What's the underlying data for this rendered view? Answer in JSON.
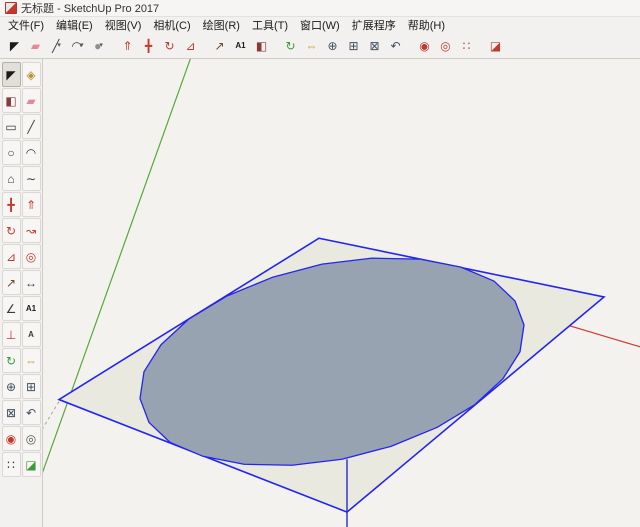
{
  "window": {
    "title": "无标题 - SketchUp Pro 2017"
  },
  "menu": {
    "items": [
      {
        "name": "menu-file",
        "label": "文件(F)"
      },
      {
        "name": "menu-edit",
        "label": "编辑(E)"
      },
      {
        "name": "menu-view",
        "label": "视图(V)"
      },
      {
        "name": "menu-camera",
        "label": "相机(C)"
      },
      {
        "name": "menu-draw",
        "label": "绘图(R)"
      },
      {
        "name": "menu-tools",
        "label": "工具(T)"
      },
      {
        "name": "menu-window",
        "label": "窗口(W)"
      },
      {
        "name": "menu-extensions",
        "label": "扩展程序"
      },
      {
        "name": "menu-help",
        "label": "帮助(H)"
      }
    ]
  },
  "top_toolbar": {
    "items": [
      {
        "name": "select-tool",
        "glyph": "◤",
        "color": "#1a1a1a"
      },
      {
        "name": "eraser-tool",
        "glyph": "▰",
        "color": "#e4889a"
      },
      {
        "name": "line-tool",
        "glyph": "╱",
        "color": "#3a3a3a",
        "dropdown": true
      },
      {
        "name": "arc-tool",
        "glyph": "◠",
        "color": "#3a3a3a",
        "dropdown": true
      },
      {
        "name": "shapes-tool",
        "glyph": "●",
        "color": "#8f8f8f",
        "dropdown": true
      },
      {
        "type": "sep"
      },
      {
        "name": "push-pull-tool",
        "glyph": "⇑",
        "color": "#c03a2e"
      },
      {
        "name": "move-tool",
        "glyph": "╋",
        "color": "#c03a2e"
      },
      {
        "name": "rotate-tool",
        "glyph": "↻",
        "color": "#c03a2e"
      },
      {
        "name": "scale-tool",
        "glyph": "⊿",
        "color": "#c03a2e"
      },
      {
        "type": "sep"
      },
      {
        "name": "tape-measure-tool",
        "glyph": "↗",
        "color": "#6b4a2a"
      },
      {
        "name": "text-tool",
        "glyph": "A1",
        "color": "#1a1a1a",
        "small": true
      },
      {
        "name": "paint-bucket-tool",
        "glyph": "◧",
        "color": "#8b3a3a"
      },
      {
        "type": "sep"
      },
      {
        "name": "orbit-tool",
        "glyph": "↻",
        "color": "#3a9b3a"
      },
      {
        "name": "pan-tool",
        "glyph": "⇔",
        "color": "#c9a23a"
      },
      {
        "name": "zoom-tool",
        "glyph": "⊕",
        "color": "#41505e"
      },
      {
        "name": "zoom-window-tool",
        "glyph": "⊞",
        "color": "#41505e"
      },
      {
        "name": "zoom-extents-tool",
        "glyph": "⊠",
        "color": "#41505e"
      },
      {
        "name": "previous-view-tool",
        "glyph": "↶",
        "color": "#41505e"
      },
      {
        "type": "sep"
      },
      {
        "name": "position-camera-tool",
        "glyph": "◉",
        "color": "#c03a2e"
      },
      {
        "name": "look-around-tool",
        "glyph": "◎",
        "color": "#c03a2e"
      },
      {
        "name": "walk-tool",
        "glyph": "∷",
        "color": "#c03a2e"
      },
      {
        "type": "sep"
      },
      {
        "name": "section-plane-tool",
        "glyph": "◪",
        "color": "#c03a2e"
      }
    ]
  },
  "left_toolbar": {
    "items": [
      {
        "name": "select-tool",
        "glyph": "◤",
        "color": "#1a1a1a",
        "active": true
      },
      {
        "name": "make-component-tool",
        "glyph": "◈",
        "color": "#b8912f"
      },
      {
        "name": "paint-bucket-tool",
        "glyph": "◧",
        "color": "#8b3a3a"
      },
      {
        "name": "eraser-tool",
        "glyph": "▰",
        "color": "#e4889a"
      },
      {
        "name": "rectangle-tool",
        "glyph": "▭",
        "color": "#3a3a3a"
      },
      {
        "name": "line-tool",
        "glyph": "╱",
        "color": "#3a3a3a"
      },
      {
        "name": "circle-tool",
        "glyph": "○",
        "color": "#3a3a3a"
      },
      {
        "name": "arc-tool",
        "glyph": "◠",
        "color": "#3a3a3a"
      },
      {
        "name": "polygon-tool",
        "glyph": "⌂",
        "color": "#3a3a3a"
      },
      {
        "name": "freehand-tool",
        "glyph": "∼",
        "color": "#3a3a3a"
      },
      {
        "name": "move-tool",
        "glyph": "╋",
        "color": "#c03a2e"
      },
      {
        "name": "push-pull-tool",
        "glyph": "⇑",
        "color": "#c03a2e"
      },
      {
        "name": "rotate-tool",
        "glyph": "↻",
        "color": "#c03a2e"
      },
      {
        "name": "follow-me-tool",
        "glyph": "↝",
        "color": "#c03a2e"
      },
      {
        "name": "scale-tool",
        "glyph": "⊿",
        "color": "#c03a2e"
      },
      {
        "name": "offset-tool",
        "glyph": "◎",
        "color": "#c03a2e"
      },
      {
        "name": "tape-measure-tool",
        "glyph": "↗",
        "color": "#6b4a2a"
      },
      {
        "name": "dimension-tool",
        "glyph": "↔",
        "color": "#3a3a3a"
      },
      {
        "name": "protractor-tool",
        "glyph": "∠",
        "color": "#3a3a3a"
      },
      {
        "name": "text-tool",
        "glyph": "A1",
        "color": "#1a1a1a",
        "small": true
      },
      {
        "name": "axes-tool",
        "glyph": "⊥",
        "color": "#c03a2e"
      },
      {
        "name": "3d-text-tool",
        "glyph": "A",
        "color": "#3a3a3a",
        "small": true
      },
      {
        "name": "orbit-tool",
        "glyph": "↻",
        "color": "#3a9b3a"
      },
      {
        "name": "pan-tool",
        "glyph": "⇔",
        "color": "#c9a23a"
      },
      {
        "name": "zoom-tool",
        "glyph": "⊕",
        "color": "#41505e"
      },
      {
        "name": "zoom-window-tool",
        "glyph": "⊞",
        "color": "#41505e"
      },
      {
        "name": "zoom-extents-tool",
        "glyph": "⊠",
        "color": "#41505e"
      },
      {
        "name": "previous-view-tool",
        "glyph": "↶",
        "color": "#41505e"
      },
      {
        "name": "position-camera-tool",
        "glyph": "◉",
        "color": "#c03a2e"
      },
      {
        "name": "look-around-tool",
        "glyph": "◎",
        "color": "#555555"
      },
      {
        "name": "walk-tool",
        "glyph": "∷",
        "color": "#333333"
      },
      {
        "name": "section-plane-tool",
        "glyph": "◪",
        "color": "#3a9b3a"
      }
    ]
  },
  "viewport": {
    "background": "#f3f2ef",
    "face_color": "#e9e9e0",
    "circle_fill": "#97a3b1",
    "selection_color": "#2424f0",
    "axes": {
      "red": "#cc3b33",
      "green": "#58a838",
      "blue": "#2929cc",
      "green_dashed": "#9aab97"
    }
  }
}
